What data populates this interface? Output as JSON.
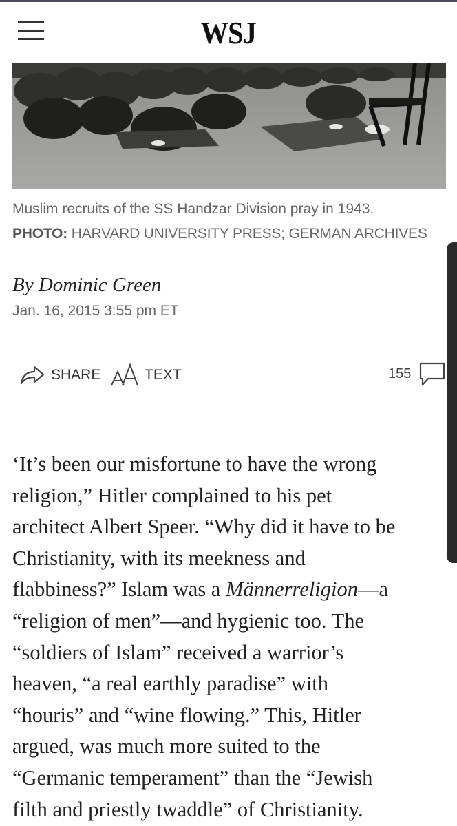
{
  "header": {
    "logo_text": "WSJ",
    "menu_icon": "hamburger-menu-icon"
  },
  "photo": {
    "caption": "Muslim recruits of the SS Handzar Division pray in 1943.",
    "credit_label": "PHOTO:",
    "credit_source": "HARVARD UNIVERSITY PRESS; GERMAN ARCHIVES"
  },
  "article": {
    "byline": "By Dominic Green",
    "date": "Jan. 16, 2015 3:55 pm ET"
  },
  "toolbar": {
    "share_label": "SHARE",
    "share_icon": "share-arrow-icon",
    "text_label": "TEXT",
    "text_size_icon": "text-size-icon",
    "comment_count": "155",
    "comment_icon": "comment-bubble-icon"
  },
  "body": {
    "l1": "‘It’s been our misfortune to have the wrong",
    "l2": "religion,” Hitler complained to his pet",
    "l3": "architect Albert Speer. “Why did it have to be",
    "l4": "Christianity, with its meekness and",
    "l5a": "flabbiness?” Islam was a ",
    "l5b": "Männerreligion",
    "l5c": "—a",
    "l6": "“religion of men”—and hygienic too. The",
    "l7": "“soldiers of Islam” received a warrior’s",
    "l8": "heaven, “a real earthly paradise” with",
    "l9": "“houris” and “wine flowing.” This, Hitler",
    "l10": "argued, was much more suited to the",
    "l11": "“Germanic temperament” than the “Jewish",
    "l12": "filth and priestly twaddle” of Christianity."
  }
}
